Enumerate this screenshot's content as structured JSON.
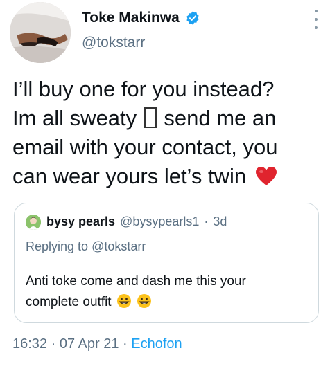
{
  "author": {
    "name": "Toke Makinwa",
    "handle": "@tokstarr",
    "verified": true
  },
  "menu_icon": "more-vertical-icon",
  "tweet": {
    "line1": "I’ll buy one for you instead?",
    "line2_before": "Im all sweaty",
    "line2_after": "send me an",
    "line3": "email with your contact, you",
    "line4": "can wear yours let’s twin",
    "heart_emoji": "red-heart-icon"
  },
  "quoted": {
    "name": "bysy pearls",
    "handle": "@bysypearls1",
    "separator": "·",
    "time": "3d",
    "replying_prefix": "Replying to",
    "replying_to": "@tokstarr",
    "text_line1": "Anti toke come and dash me this your",
    "text_line2": "complete outfit",
    "emoji": "grinning-face-icon"
  },
  "footer": {
    "time": "16:32",
    "sep1": "·",
    "date": "07 Apr 21",
    "sep2": "·",
    "source": "Echofon"
  },
  "colors": {
    "text": "#0f1419",
    "muted": "#5b7083",
    "link": "#1da1f2",
    "verified": "#1da1f2",
    "heart": "#e0242e",
    "border": "#cfd9de"
  }
}
